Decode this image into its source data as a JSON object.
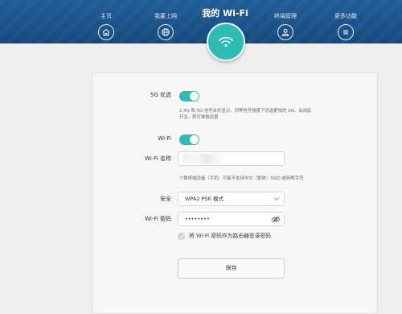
{
  "nav": {
    "items": [
      {
        "label": "主页",
        "icon": "home-icon"
      },
      {
        "label": "我要上网",
        "icon": "globe-icon"
      },
      {
        "label": "终端管理",
        "icon": "user-icon"
      },
      {
        "label": "更多功能",
        "icon": "menu-icon"
      }
    ],
    "active": {
      "label": "我的 Wi-Fi",
      "icon": "wifi-icon"
    },
    "bar_color": "#1f5d98",
    "accent_color": "#2dbcb4"
  },
  "settings": {
    "five_g": {
      "label": "5G 优选",
      "enabled": true
    },
    "five_g_hint": "2.4G 和 5G 信号合并显示，同等信号强度下优选更快的 5G。关闭此开关，即可单独设置",
    "wifi": {
      "label": "Wi-Fi",
      "enabled": true
    },
    "wifi_name": {
      "label": "Wi-Fi 名称",
      "value": ""
    },
    "wifi_name_hint": "少数终端设备（手机）可能不支持中文（繁体）SSID 或特殊字符",
    "security": {
      "label": "安全",
      "value": "WPA2 PSK 模式"
    },
    "password": {
      "label": "Wi-Fi 密码",
      "value": "••••••••"
    },
    "admin_password_option": {
      "label": "将 Wi-Fi 密码作为路由器登录密码",
      "checked": true
    },
    "save_label": "保存"
  }
}
